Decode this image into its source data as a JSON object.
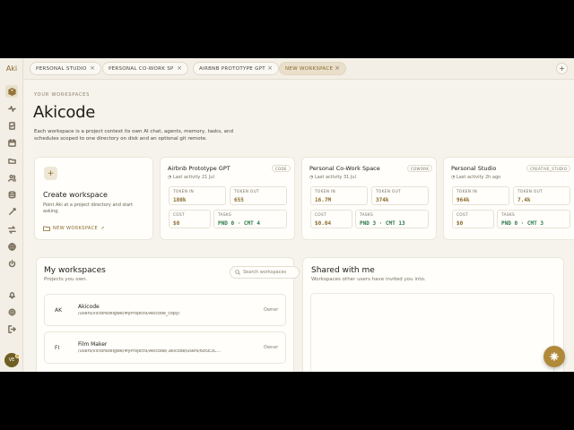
{
  "app": {
    "brand": "Aki"
  },
  "tabs": [
    {
      "label": "PERSONAL STUDIO"
    },
    {
      "label": "PERSONAL CO-WORK SP..."
    },
    {
      "label": "AIRBNB PROTOTYPE GPT"
    },
    {
      "label": "NEW WORKSPACE"
    }
  ],
  "tab_close_glyph": "×",
  "tab_add_glyph": "+",
  "header": {
    "eyebrow": "YOUR WORKSPACES",
    "title": "Akicode",
    "description": "Each workspace is a project context its own AI chat, agents, memory, tasks, and schedules scoped to one directory on disk and an optional git remote."
  },
  "create_card": {
    "icon_glyph": "+",
    "title": "Create workspace",
    "description": "Point Aki at a project directory and start asking.",
    "link_label": "NEW WORKSPACE",
    "link_arrow": "↗"
  },
  "workspace_cards": [
    {
      "name": "Airbnb Prototype GPT",
      "badge": "CODE",
      "activity": "Last activity 21 Jul",
      "token_in_label": "TOKEN IN",
      "token_in": "180k",
      "token_out_label": "TOKEN OUT",
      "token_out": "655",
      "cost_label": "COST",
      "cost": "$0",
      "tasks_label": "TASKS",
      "tasks": "PND 0 · CMT 4"
    },
    {
      "name": "Personal Co-Work Space",
      "badge": "COWORK",
      "activity": "Last activity 31 Jul",
      "token_in_label": "TOKEN IN",
      "token_in": "16.7M",
      "token_out_label": "TOKEN OUT",
      "token_out": "374k",
      "cost_label": "COST",
      "cost": "$0.04",
      "tasks_label": "TASKS",
      "tasks": "PND 3 · CMT 13"
    },
    {
      "name": "Personal Studio",
      "badge": "CREATIVE_STUDIO",
      "activity": "Last activity 2h ago",
      "token_in_label": "TOKEN IN",
      "token_in": "964k",
      "token_out_label": "TOKEN OUT",
      "token_out": "7.4k",
      "cost_label": "COST",
      "cost": "$0",
      "tasks_label": "TASKS",
      "tasks": "PND 0 · CMT 3"
    }
  ],
  "my_workspaces": {
    "title": "My workspaces",
    "subtitle": "Projects you own.",
    "search_placeholder": "Search workspaces",
    "rows": [
      {
        "initials": "AK",
        "name": "Akicode",
        "path": "/Users/victorezeigwe/MyProjects/Akicode_copy/",
        "role": "Owner"
      },
      {
        "initials": "FI",
        "name": "Film Maker",
        "path": "/Users/victorezeigwe/MyProjects/Akicode/.akicode/users/6d5E3C...",
        "role": "Owner"
      }
    ]
  },
  "shared": {
    "title": "Shared with me",
    "subtitle": "Workspaces other users have invited you into."
  },
  "user": {
    "initials": "VE"
  },
  "colors": {
    "accent": "#8a6a2a",
    "background": "#f6f3ec",
    "fab": "#b08a3a",
    "success": "#2f7a48"
  },
  "rail_icons": [
    "layers-icon",
    "activity-icon",
    "checklist-icon",
    "calendar-icon",
    "folder-icon",
    "users-icon",
    "database-icon",
    "wand-icon",
    "transfer-icon",
    "globe-icon",
    "power-icon",
    "bell-icon",
    "settings-icon",
    "logout-icon"
  ]
}
